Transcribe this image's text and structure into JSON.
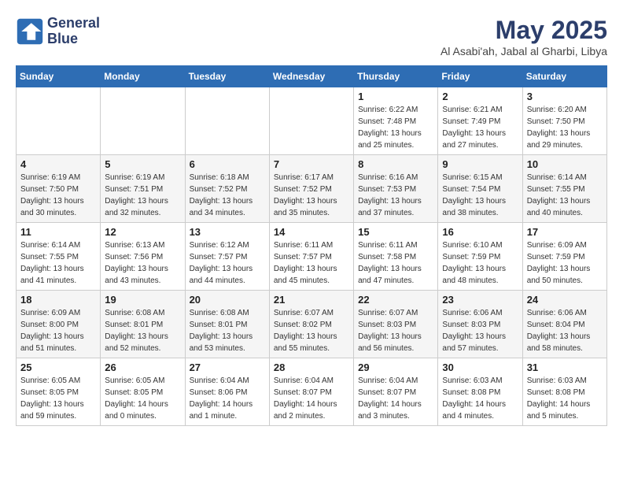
{
  "header": {
    "logo_line1": "General",
    "logo_line2": "Blue",
    "month": "May 2025",
    "location": "Al Asabi'ah, Jabal al Gharbi, Libya"
  },
  "weekdays": [
    "Sunday",
    "Monday",
    "Tuesday",
    "Wednesday",
    "Thursday",
    "Friday",
    "Saturday"
  ],
  "weeks": [
    [
      {
        "day": "",
        "info": ""
      },
      {
        "day": "",
        "info": ""
      },
      {
        "day": "",
        "info": ""
      },
      {
        "day": "",
        "info": ""
      },
      {
        "day": "1",
        "info": "Sunrise: 6:22 AM\nSunset: 7:48 PM\nDaylight: 13 hours\nand 25 minutes."
      },
      {
        "day": "2",
        "info": "Sunrise: 6:21 AM\nSunset: 7:49 PM\nDaylight: 13 hours\nand 27 minutes."
      },
      {
        "day": "3",
        "info": "Sunrise: 6:20 AM\nSunset: 7:50 PM\nDaylight: 13 hours\nand 29 minutes."
      }
    ],
    [
      {
        "day": "4",
        "info": "Sunrise: 6:19 AM\nSunset: 7:50 PM\nDaylight: 13 hours\nand 30 minutes."
      },
      {
        "day": "5",
        "info": "Sunrise: 6:19 AM\nSunset: 7:51 PM\nDaylight: 13 hours\nand 32 minutes."
      },
      {
        "day": "6",
        "info": "Sunrise: 6:18 AM\nSunset: 7:52 PM\nDaylight: 13 hours\nand 34 minutes."
      },
      {
        "day": "7",
        "info": "Sunrise: 6:17 AM\nSunset: 7:52 PM\nDaylight: 13 hours\nand 35 minutes."
      },
      {
        "day": "8",
        "info": "Sunrise: 6:16 AM\nSunset: 7:53 PM\nDaylight: 13 hours\nand 37 minutes."
      },
      {
        "day": "9",
        "info": "Sunrise: 6:15 AM\nSunset: 7:54 PM\nDaylight: 13 hours\nand 38 minutes."
      },
      {
        "day": "10",
        "info": "Sunrise: 6:14 AM\nSunset: 7:55 PM\nDaylight: 13 hours\nand 40 minutes."
      }
    ],
    [
      {
        "day": "11",
        "info": "Sunrise: 6:14 AM\nSunset: 7:55 PM\nDaylight: 13 hours\nand 41 minutes."
      },
      {
        "day": "12",
        "info": "Sunrise: 6:13 AM\nSunset: 7:56 PM\nDaylight: 13 hours\nand 43 minutes."
      },
      {
        "day": "13",
        "info": "Sunrise: 6:12 AM\nSunset: 7:57 PM\nDaylight: 13 hours\nand 44 minutes."
      },
      {
        "day": "14",
        "info": "Sunrise: 6:11 AM\nSunset: 7:57 PM\nDaylight: 13 hours\nand 45 minutes."
      },
      {
        "day": "15",
        "info": "Sunrise: 6:11 AM\nSunset: 7:58 PM\nDaylight: 13 hours\nand 47 minutes."
      },
      {
        "day": "16",
        "info": "Sunrise: 6:10 AM\nSunset: 7:59 PM\nDaylight: 13 hours\nand 48 minutes."
      },
      {
        "day": "17",
        "info": "Sunrise: 6:09 AM\nSunset: 7:59 PM\nDaylight: 13 hours\nand 50 minutes."
      }
    ],
    [
      {
        "day": "18",
        "info": "Sunrise: 6:09 AM\nSunset: 8:00 PM\nDaylight: 13 hours\nand 51 minutes."
      },
      {
        "day": "19",
        "info": "Sunrise: 6:08 AM\nSunset: 8:01 PM\nDaylight: 13 hours\nand 52 minutes."
      },
      {
        "day": "20",
        "info": "Sunrise: 6:08 AM\nSunset: 8:01 PM\nDaylight: 13 hours\nand 53 minutes."
      },
      {
        "day": "21",
        "info": "Sunrise: 6:07 AM\nSunset: 8:02 PM\nDaylight: 13 hours\nand 55 minutes."
      },
      {
        "day": "22",
        "info": "Sunrise: 6:07 AM\nSunset: 8:03 PM\nDaylight: 13 hours\nand 56 minutes."
      },
      {
        "day": "23",
        "info": "Sunrise: 6:06 AM\nSunset: 8:03 PM\nDaylight: 13 hours\nand 57 minutes."
      },
      {
        "day": "24",
        "info": "Sunrise: 6:06 AM\nSunset: 8:04 PM\nDaylight: 13 hours\nand 58 minutes."
      }
    ],
    [
      {
        "day": "25",
        "info": "Sunrise: 6:05 AM\nSunset: 8:05 PM\nDaylight: 13 hours\nand 59 minutes."
      },
      {
        "day": "26",
        "info": "Sunrise: 6:05 AM\nSunset: 8:05 PM\nDaylight: 14 hours\nand 0 minutes."
      },
      {
        "day": "27",
        "info": "Sunrise: 6:04 AM\nSunset: 8:06 PM\nDaylight: 14 hours\nand 1 minute."
      },
      {
        "day": "28",
        "info": "Sunrise: 6:04 AM\nSunset: 8:07 PM\nDaylight: 14 hours\nand 2 minutes."
      },
      {
        "day": "29",
        "info": "Sunrise: 6:04 AM\nSunset: 8:07 PM\nDaylight: 14 hours\nand 3 minutes."
      },
      {
        "day": "30",
        "info": "Sunrise: 6:03 AM\nSunset: 8:08 PM\nDaylight: 14 hours\nand 4 minutes."
      },
      {
        "day": "31",
        "info": "Sunrise: 6:03 AM\nSunset: 8:08 PM\nDaylight: 14 hours\nand 5 minutes."
      }
    ]
  ]
}
